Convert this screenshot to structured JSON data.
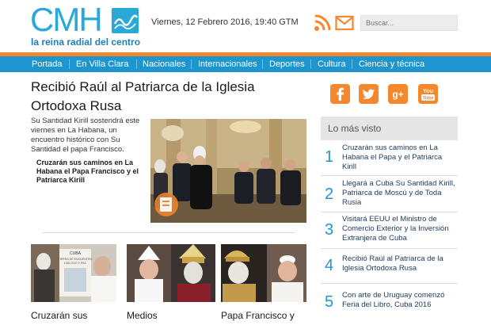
{
  "header": {
    "logo_letters": "CMH",
    "tagline": "la reina radial del centro",
    "date": "Viernes, 12 Febrero 2016, 19:40 GTM",
    "search_placeholder": "Buscar...",
    "rss_icon": "rss-icon",
    "mail_icon": "mail-icon"
  },
  "nav": {
    "items": [
      "Portada",
      "En Villa Clara",
      "Nacionales",
      "Internacionales",
      "Deportes",
      "Cultura",
      "Ciencia y técnica"
    ]
  },
  "main": {
    "headline": "Recibió Raúl al Patriarca de la Iglesia Ortodoxa Rusa",
    "lead": "Su Santidad Kirill sostendrá este viernes en La Habana, un encuentro histórico con Su Santidad el papa Francisco.",
    "related": "Cruzarán sus caminos en La Habana el Papa Francisco y el Patriarca Kirill",
    "thumbs": [
      {
        "title": "Cruzarán sus",
        "poster_line1": "CUBA",
        "poster_line2": "TIERRA DE ENCUENTRO",
        "poster_line3": "DIÁLOGO Y PAZ"
      },
      {
        "title": "Medios"
      },
      {
        "title": "Papa Francisco y"
      }
    ]
  },
  "sidebar": {
    "social": [
      "facebook-icon",
      "twitter-icon",
      "google-plus-icon",
      "youtube-icon"
    ],
    "gplus_label": "g+",
    "youtube_label_1": "You",
    "youtube_label_2": "Tube",
    "most_viewed_title": "Lo más visto",
    "most_viewed": [
      {
        "num": "1",
        "text": "Cruzarán sus caminos en La Habana el Papa y el Patriarca Kirill"
      },
      {
        "num": "2",
        "text": "Llegará a Cuba Su Santidad Kirill, Patriarca de Moscú y de Toda Rusia"
      },
      {
        "num": "3",
        "text": "Visitará EEUU el Ministro de Comercio Exterior y la Inversión Extranjera de Cuba"
      },
      {
        "num": "4",
        "text": "Recibió Raúl al Patriarca de la Iglesia Ortodoxa Rusa"
      },
      {
        "num": "5",
        "text": "Con arte de Uruguay comenzó Feria del Libro, Cuba 2016"
      }
    ]
  },
  "colors": {
    "brand_blue": "#1e95cf",
    "logo_blue": "#29a9d8",
    "accent_orange": "#f5872c"
  }
}
